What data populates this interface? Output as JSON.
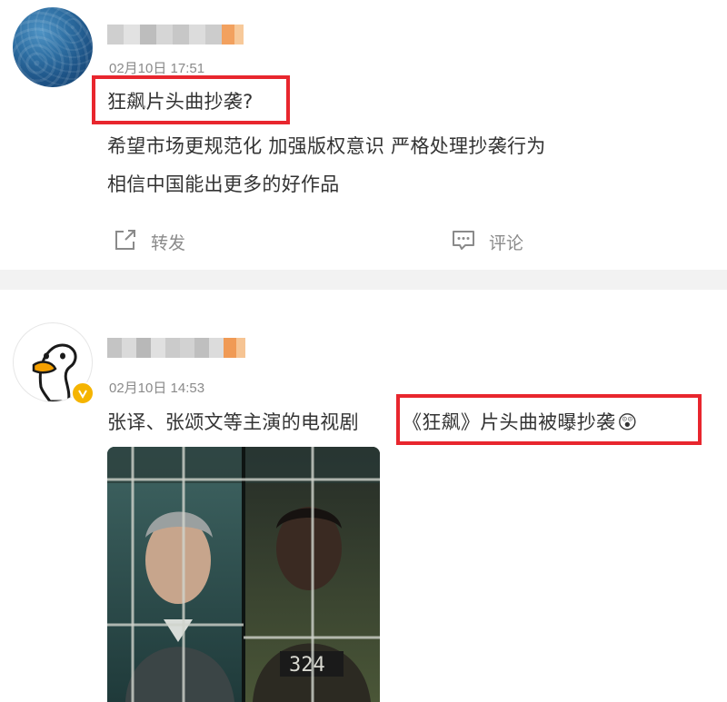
{
  "posts": [
    {
      "timestamp": "02月10日 17:51",
      "highlight_text": "狂飙片头曲抄袭?",
      "lines": [
        "希望市场更规范化 加强版权意识 严格处理抄袭行为",
        "相信中国能出更多的好作品"
      ],
      "actions": {
        "repost_label": "转发",
        "comment_label": "评论"
      }
    },
    {
      "timestamp": "02月10日 14:53",
      "text_prefix": "张译、张颂文等主演的电视剧",
      "highlight_text": "《狂飙》片头曲被曝抄袭",
      "emoji": "😲",
      "photo_label": "324"
    }
  ],
  "colors": {
    "accent_red": "#e8262e",
    "meta_gray": "#8a8a8a",
    "verified_gold": "#f5b400"
  },
  "icons": [
    "repost-icon",
    "comment-icon",
    "verified-icon",
    "goose-avatar-icon"
  ]
}
